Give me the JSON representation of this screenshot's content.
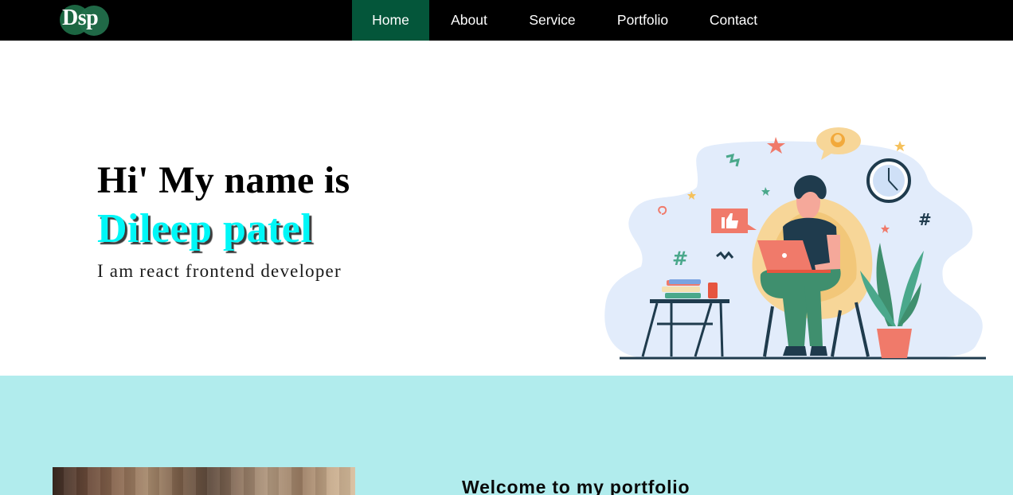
{
  "logo": {
    "text": "Dsp",
    "color": "#1d6b46"
  },
  "nav": {
    "items": [
      {
        "label": "Home",
        "active": true
      },
      {
        "label": "About",
        "active": false
      },
      {
        "label": "Service",
        "active": false
      },
      {
        "label": "Portfolio",
        "active": false
      },
      {
        "label": "Contact",
        "active": false
      }
    ],
    "active_color": "#04563a",
    "background": "#000000"
  },
  "hero": {
    "greeting": "Hi' My name is",
    "name": "Dileep patel",
    "role": "I am react frontend developer",
    "name_color": "#00f7f7",
    "illustration": "developer-with-laptop-illustration"
  },
  "about": {
    "title": "Welcome to my portfolio",
    "background": "#b1eced",
    "image": "blurred-bookshelf-photo"
  }
}
